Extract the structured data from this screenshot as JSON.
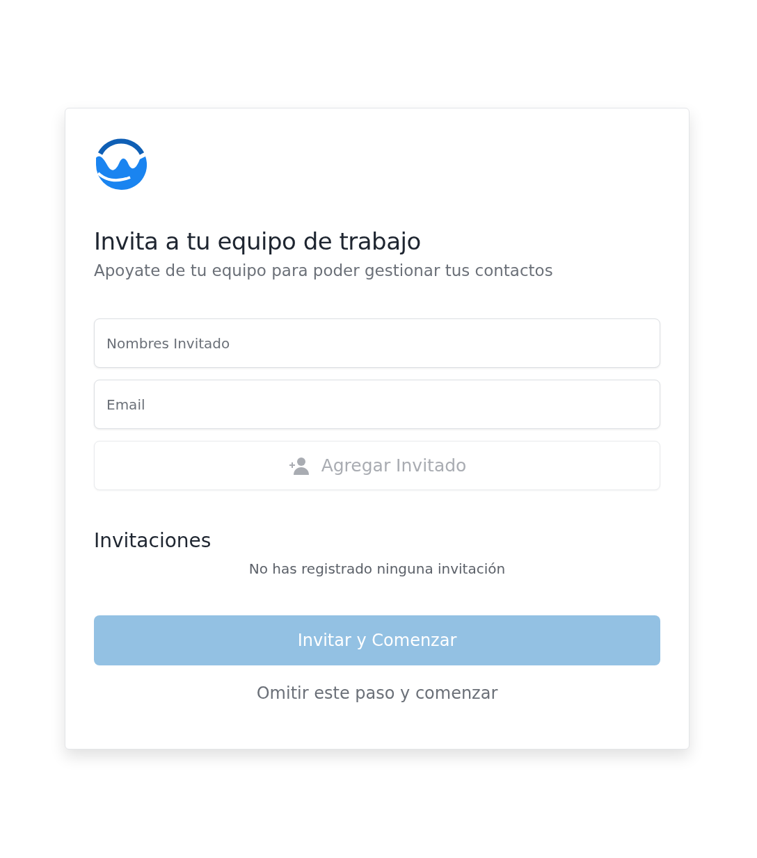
{
  "title": "Invita a tu equipo de trabajo",
  "subtitle": "Apoyate de tu equipo para poder gestionar tus contactos",
  "fields": [
    {
      "placeholder": "Nombres Invitado"
    },
    {
      "placeholder": "Email"
    }
  ],
  "add_button": {
    "label": "Agregar Invitado",
    "disabled": true
  },
  "invitations": {
    "heading": "Invitaciones",
    "empty_text": "No has registrado ninguna invitación"
  },
  "primary_button": {
    "label": "Invitar y Comenzar",
    "disabled": true
  },
  "skip_link": "Omitir este paso y comenzar"
}
